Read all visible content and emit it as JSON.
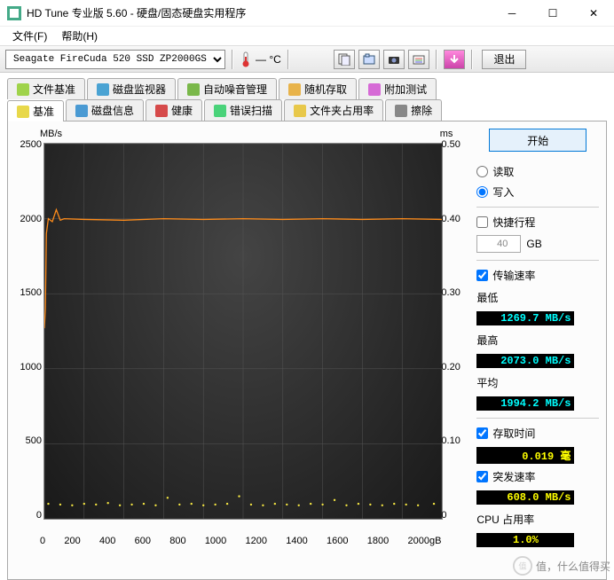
{
  "title": "HD Tune 专业版 5.60 - 硬盘/固态硬盘实用程序",
  "menu": {
    "file": "文件(F)",
    "help": "帮助(H)"
  },
  "toolbar": {
    "drive": "Seagate FireCuda 520 SSD ZP2000GS",
    "temp": "— °C",
    "exit": "退出"
  },
  "tabs_top": [
    {
      "label": "文件基准",
      "icon": "#9FD34A"
    },
    {
      "label": "磁盘监视器",
      "icon": "#4AA3D3"
    },
    {
      "label": "自动噪音管理",
      "icon": "#7AB84A"
    },
    {
      "label": "随机存取",
      "icon": "#E8B34A"
    },
    {
      "label": "附加测试",
      "icon": "#D66AD6"
    }
  ],
  "tabs_bottom": [
    {
      "label": "基准",
      "icon": "#E8D84A",
      "active": true
    },
    {
      "label": "磁盘信息",
      "icon": "#4A9AD3"
    },
    {
      "label": "健康",
      "icon": "#D64A4A"
    },
    {
      "label": "错误扫描",
      "icon": "#4AD37A"
    },
    {
      "label": "文件夹占用率",
      "icon": "#E8C84A"
    },
    {
      "label": "擦除",
      "icon": "#888888"
    }
  ],
  "chart": {
    "y_left_unit": "MB/s",
    "y_right_unit": "ms",
    "y_left": [
      "2500",
      "2000",
      "1500",
      "1000",
      "500",
      "0"
    ],
    "y_right": [
      "0.50",
      "0.40",
      "0.30",
      "0.20",
      "0.10",
      "0"
    ],
    "x": [
      "0",
      "200",
      "400",
      "600",
      "800",
      "1000",
      "1200",
      "1400",
      "1600",
      "1800",
      "2000gB"
    ]
  },
  "side": {
    "start": "开始",
    "read": "读取",
    "write": "写入",
    "shortstroke": "快捷行程",
    "shortstroke_val": "40",
    "shortstroke_unit": "GB",
    "transfer": "传输速率",
    "min_label": "最低",
    "min_value": "1269.7 MB/s",
    "max_label": "最高",
    "max_value": "2073.0 MB/s",
    "avg_label": "平均",
    "avg_value": "1994.2 MB/s",
    "access_label": "存取时间",
    "access_value": "0.019 毫",
    "burst_label": "突发速率",
    "burst_value": "608.0 MB/s",
    "cpu_label": "CPU 占用率",
    "cpu_value": "1.0%"
  },
  "watermark": "值，什么值得买",
  "chart_data": {
    "type": "line",
    "title": "",
    "xlabel": "gB",
    "ylabel_left": "MB/s",
    "ylabel_right": "ms",
    "xlim": [
      0,
      2000
    ],
    "ylim_left": [
      0,
      2500
    ],
    "ylim_right": [
      0,
      0.5
    ],
    "series": [
      {
        "name": "传输速率 (MB/s)",
        "axis": "left",
        "color": "#ff8c1a",
        "x": [
          0,
          5,
          10,
          20,
          40,
          60,
          80,
          100,
          200,
          400,
          600,
          800,
          1000,
          1200,
          1400,
          1600,
          1800,
          2000
        ],
        "y": [
          1270,
          1400,
          1900,
          2000,
          1980,
          2060,
          1990,
          2000,
          1995,
          1990,
          2000,
          1995,
          2000,
          1995,
          2000,
          1995,
          2000,
          1995
        ]
      },
      {
        "name": "存取时间 (ms)",
        "axis": "right",
        "color": "#f5e642",
        "style": "scatter",
        "x": [
          20,
          80,
          140,
          200,
          260,
          320,
          380,
          440,
          500,
          560,
          620,
          680,
          740,
          800,
          860,
          920,
          980,
          1040,
          1100,
          1160,
          1220,
          1280,
          1340,
          1400,
          1460,
          1520,
          1580,
          1640,
          1700,
          1760,
          1820,
          1880,
          1960
        ],
        "y": [
          0.02,
          0.019,
          0.018,
          0.02,
          0.019,
          0.021,
          0.018,
          0.019,
          0.02,
          0.018,
          0.028,
          0.019,
          0.02,
          0.018,
          0.019,
          0.02,
          0.03,
          0.019,
          0.018,
          0.02,
          0.019,
          0.018,
          0.02,
          0.019,
          0.025,
          0.018,
          0.02,
          0.019,
          0.018,
          0.02,
          0.019,
          0.018,
          0.02
        ]
      }
    ]
  }
}
